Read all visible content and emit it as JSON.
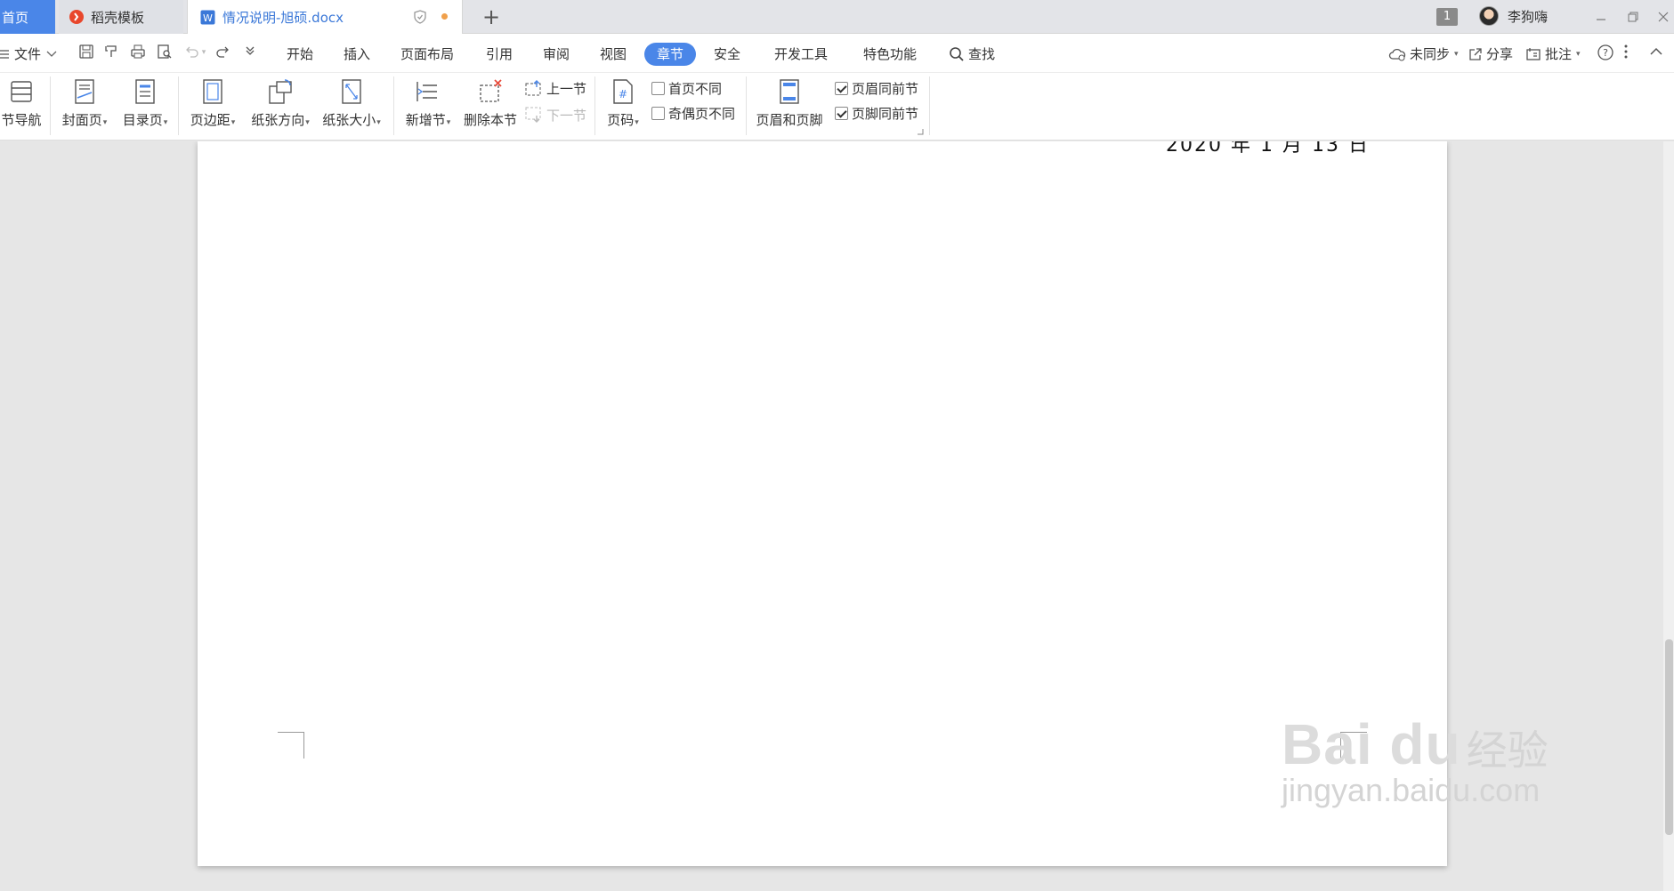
{
  "tabs": {
    "home": "首页",
    "template": "稻壳模板",
    "document": "情况说明-旭硕.docx",
    "window_count": "1",
    "user_name": "李狗嗨"
  },
  "menu": {
    "file": "文件",
    "items": [
      "开始",
      "插入",
      "页面布局",
      "引用",
      "审阅",
      "视图",
      "章节",
      "安全",
      "开发工具",
      "特色功能"
    ],
    "active": "章节",
    "search": "查找",
    "sync": "未同步",
    "share": "分享",
    "comment": "批注"
  },
  "ribbon": {
    "section_nav": "节导航",
    "cover_page": "封面页",
    "toc_page": "目录页",
    "margins": "页边距",
    "orientation": "纸张方向",
    "paper_size": "纸张大小",
    "add_section": "新增节",
    "delete_section": "删除本节",
    "prev_section": "上一节",
    "next_section": "下一节",
    "page_number": "页码",
    "first_page_diff": "首页不同",
    "odd_even_diff": "奇偶页不同",
    "header_footer": "页眉和页脚",
    "header_same_prev": "页眉同前节",
    "footer_same_prev": "页脚同前节"
  },
  "checkboxes": {
    "first_page_diff": false,
    "odd_even_diff": false,
    "header_same_prev": true,
    "footer_same_prev": true
  },
  "document": {
    "date_text": "2020 年 1 月 13 日"
  },
  "watermark": {
    "logo": "Bai du",
    "brand_cn": "经验",
    "url": "jingyan.baidu.com"
  },
  "colors": {
    "accent": "#4a86e8",
    "doc_tab_text": "#3b78d8",
    "unsaved_dot": "#f0a04b"
  }
}
